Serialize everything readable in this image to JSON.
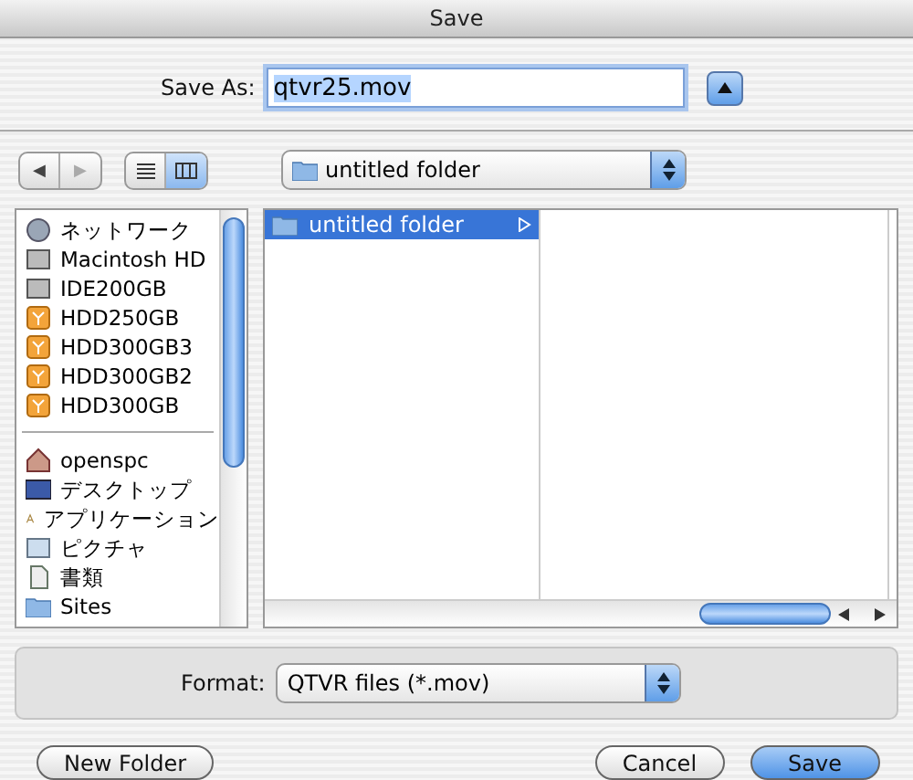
{
  "window": {
    "title": "Save"
  },
  "save_as": {
    "label": "Save As:",
    "value": "qtvr25.mov",
    "expanded": true
  },
  "nav": {
    "back": {
      "symbol": "◀",
      "disabled": false
    },
    "forward": {
      "symbol": "▶",
      "disabled": true
    }
  },
  "view_modes": [
    {
      "kind": "list",
      "selected": false
    },
    {
      "kind": "columns",
      "selected": true
    }
  ],
  "location": {
    "value": "untitled folder"
  },
  "sidebar": {
    "groups": [
      {
        "items": [
          {
            "kind": "network",
            "label": "ネットワーク"
          },
          {
            "kind": "disk",
            "label": "Macintosh HD"
          },
          {
            "kind": "disk",
            "label": "IDE200GB"
          },
          {
            "kind": "drive",
            "label": "HDD250GB"
          },
          {
            "kind": "drive",
            "label": "HDD300GB3"
          },
          {
            "kind": "drive",
            "label": "HDD300GB2"
          },
          {
            "kind": "drive",
            "label": "HDD300GB"
          }
        ]
      },
      {
        "items": [
          {
            "kind": "home",
            "label": "openspc"
          },
          {
            "kind": "desktop",
            "label": "デスクトップ"
          },
          {
            "kind": "apps",
            "label": "アプリケーション"
          },
          {
            "kind": "pictures",
            "label": "ピクチャ"
          },
          {
            "kind": "docs",
            "label": "書類"
          },
          {
            "kind": "folder",
            "label": "Sites"
          }
        ]
      }
    ]
  },
  "columns": [
    {
      "items": [
        {
          "label": "untitled folder",
          "selected": true
        }
      ]
    },
    {}
  ],
  "format": {
    "label": "Format:",
    "value": "QTVR files (*.mov)"
  },
  "buttons": {
    "new_folder": "New Folder",
    "cancel": "Cancel",
    "save": "Save"
  }
}
